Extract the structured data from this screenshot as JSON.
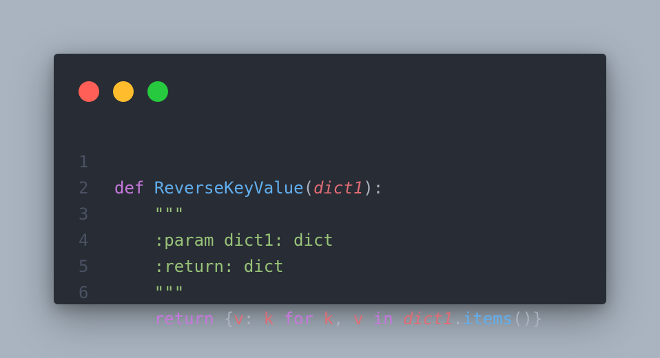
{
  "window": {
    "controls": {
      "close_color": "#ff5f56",
      "minimize_color": "#ffbd2e",
      "maximize_color": "#27c93f"
    }
  },
  "code": {
    "language": "python",
    "lines": [
      {
        "number": "1",
        "text": "def ReverseKeyValue(dict1):"
      },
      {
        "number": "2",
        "text": "    \"\"\""
      },
      {
        "number": "3",
        "text": "    :param dict1: dict"
      },
      {
        "number": "4",
        "text": "    :return: dict"
      },
      {
        "number": "5",
        "text": "    \"\"\""
      },
      {
        "number": "6",
        "text": "    return {v: k for k, v in dict1.items()}"
      }
    ],
    "tokens": {
      "def": "def",
      "func_name": "ReverseKeyValue",
      "open_paren": "(",
      "param": "dict1",
      "close_paren_colon": "):",
      "docstring_open": "\"\"\"",
      "param_doc": ":param dict1: dict",
      "return_doc": ":return: dict",
      "docstring_close": "\"\"\"",
      "return_kw": "return",
      "brace_open": "{",
      "v1": "v",
      "colon": ": ",
      "k1": "k",
      "for_kw": "for",
      "k2": "k",
      "comma": ", ",
      "v2": "v",
      "in_kw": "in",
      "dict_ref": "dict1",
      "dot": ".",
      "items_fn": "items",
      "call_close": "()}"
    }
  },
  "colors": {
    "background": "#a9b4c0",
    "editor": "#282c34",
    "keyword": "#c678dd",
    "function": "#61afef",
    "variable": "#e06c75",
    "string": "#98c379",
    "line_number": "#4b5263",
    "text": "#abb2bf"
  }
}
